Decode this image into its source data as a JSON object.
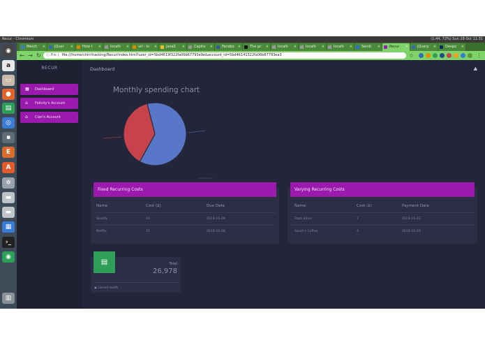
{
  "os": {
    "window_title": "Recur - Chromium",
    "status": "(1:44, 72%)  Sun 28 Oct 11:31"
  },
  "browser": {
    "tabs": [
      {
        "label": "Merch",
        "color": "#3b7bc8"
      },
      {
        "label": "jQuer",
        "color": "#2f6db3"
      },
      {
        "label": "How t",
        "color": "#e28a00"
      },
      {
        "label": "localh",
        "color": "#999999"
      },
      {
        "label": "url - In",
        "color": "#e28a00"
      },
      {
        "label": "JavaS",
        "color": "#f0c02a"
      },
      {
        "label": "Capita",
        "color": "#999999"
      },
      {
        "label": "Facebo",
        "color": "#3b5998"
      },
      {
        "label": "The pr",
        "color": "#111111"
      },
      {
        "label": "localh",
        "color": "#999999"
      },
      {
        "label": "localh",
        "color": "#999999"
      },
      {
        "label": "localh",
        "color": "#999999"
      },
      {
        "label": "Sendi",
        "color": "#2d6fd1"
      },
      {
        "label": "Recur",
        "color": "#9b1aae"
      },
      {
        "label": "jQuery",
        "color": "#2f6db3"
      },
      {
        "label": "Devpo",
        "color": "#0f2a5a"
      }
    ],
    "active_tab_index": 13,
    "address": {
      "protocol": "File",
      "url": "file:///home/chirr/hacking/Recur/index.html?user_id=5bd4613f322fa06b67793e9e&account_id=5bd46141322fa06b67793ea3"
    }
  },
  "app": {
    "brand": "RECUR",
    "page_title": "Dashboard",
    "sidebar": {
      "items": [
        {
          "label": "Dashboard"
        },
        {
          "label": "Felicity's Account"
        },
        {
          "label": "Cian's Account"
        }
      ]
    },
    "chart_title": "Monthly spending chart",
    "chart_credit": "CanvasJS.com",
    "chart_data": {
      "type": "pie",
      "title": "Monthly spending chart",
      "slices": [
        {
          "label": "",
          "value": 62,
          "color": "#5877c8"
        },
        {
          "label": "",
          "value": 38,
          "color": "#c7434b"
        }
      ]
    },
    "fixed": {
      "title": "Fixed Recurring Costs",
      "columns": [
        "Name",
        "Cost (£)",
        "Due Date"
      ],
      "rows": [
        [
          "Spotify",
          "10",
          "2018-10-28"
        ],
        [
          "Netflix",
          "15",
          "2018-10-28"
        ]
      ]
    },
    "varying": {
      "title": "Varying Recurring Costs",
      "columns": [
        "Name",
        "Cost (£)",
        "Payment Date"
      ],
      "rows": [
        [
          "Papa Johns",
          "7",
          "2018-10-23"
        ],
        [
          "Sarah's Coffee",
          "4",
          "2018-10-23"
        ]
      ]
    },
    "stat": {
      "label": "Total",
      "value": "26,978",
      "footer": "Current month"
    }
  }
}
